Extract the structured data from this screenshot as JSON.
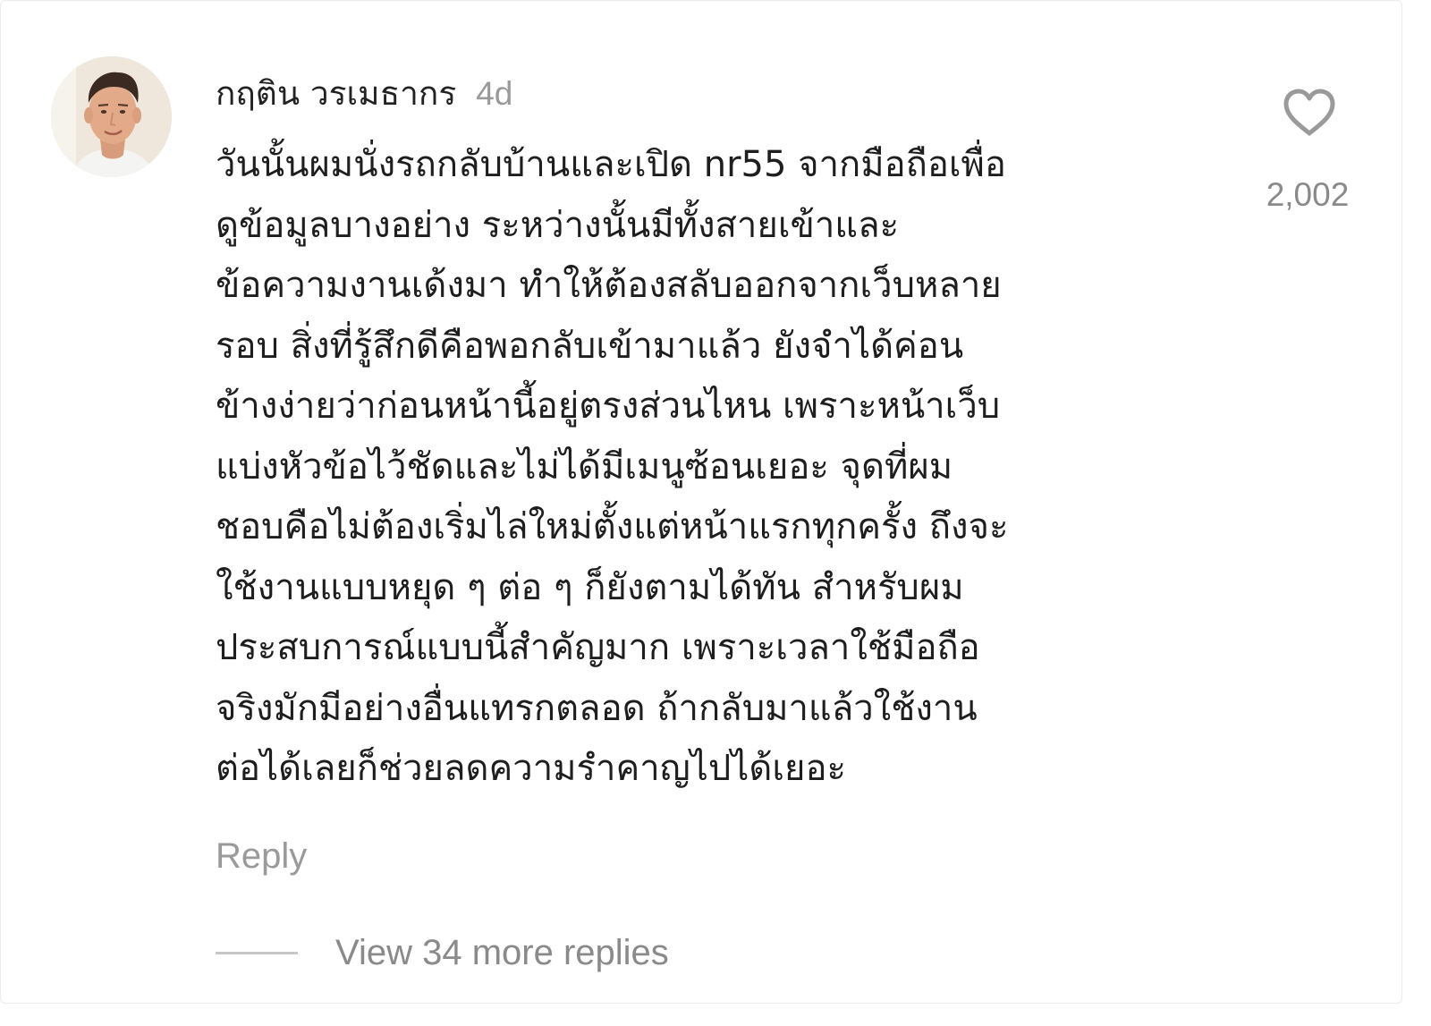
{
  "comment": {
    "username": "กฤติน วรเมธากร",
    "timestamp": "4d",
    "avatar_icon": "user-avatar-photo",
    "text_lines": [
      "วันนั้นผมนั่งรถกลับบ้านและเปิด nr55 จากมือถือเพื่อ",
      "ดูข้อมูลบางอย่าง ระหว่างนั้นมีทั้งสายเข้าและ",
      "ข้อความงานเด้งมา ทำให้ต้องสลับออกจากเว็บหลาย",
      "รอบ สิ่งที่รู้สึกดีคือพอกลับเข้ามาแล้ว ยังจำได้ค่อน",
      "ข้างง่ายว่าก่อนหน้านี้อยู่ตรงส่วนไหน เพราะหน้าเว็บ",
      "แบ่งหัวข้อไว้ชัดและไม่ได้มีเมนูซ้อนเยอะ จุดที่ผม",
      "ชอบคือไม่ต้องเริ่มไล่ใหม่ตั้งแต่หน้าแรกทุกครั้ง ถึงจะ",
      "ใช้งานแบบหยุด ๆ ต่อ ๆ ก็ยังตามได้ทัน สำหรับผม",
      "ประสบการณ์แบบนี้สำคัญมาก เพราะเวลาใช้มือถือ",
      "จริงมักมีอย่างอื่นแทรกตลอด ถ้ากลับมาแล้วใช้งาน",
      "ต่อได้เลยก็ช่วยลดความรำคาญไปได้เยอะ"
    ],
    "like_icon": "heart-outline-icon",
    "like_count": "2,002",
    "reply_label": "Reply",
    "view_replies_label": "View 34 more replies"
  },
  "colors": {
    "username": "#222222",
    "body_text": "#1e1e1e",
    "muted_text": "#9a9a9a",
    "heart_stroke": "#9a9a9a",
    "divider": "#c7c7c7"
  }
}
